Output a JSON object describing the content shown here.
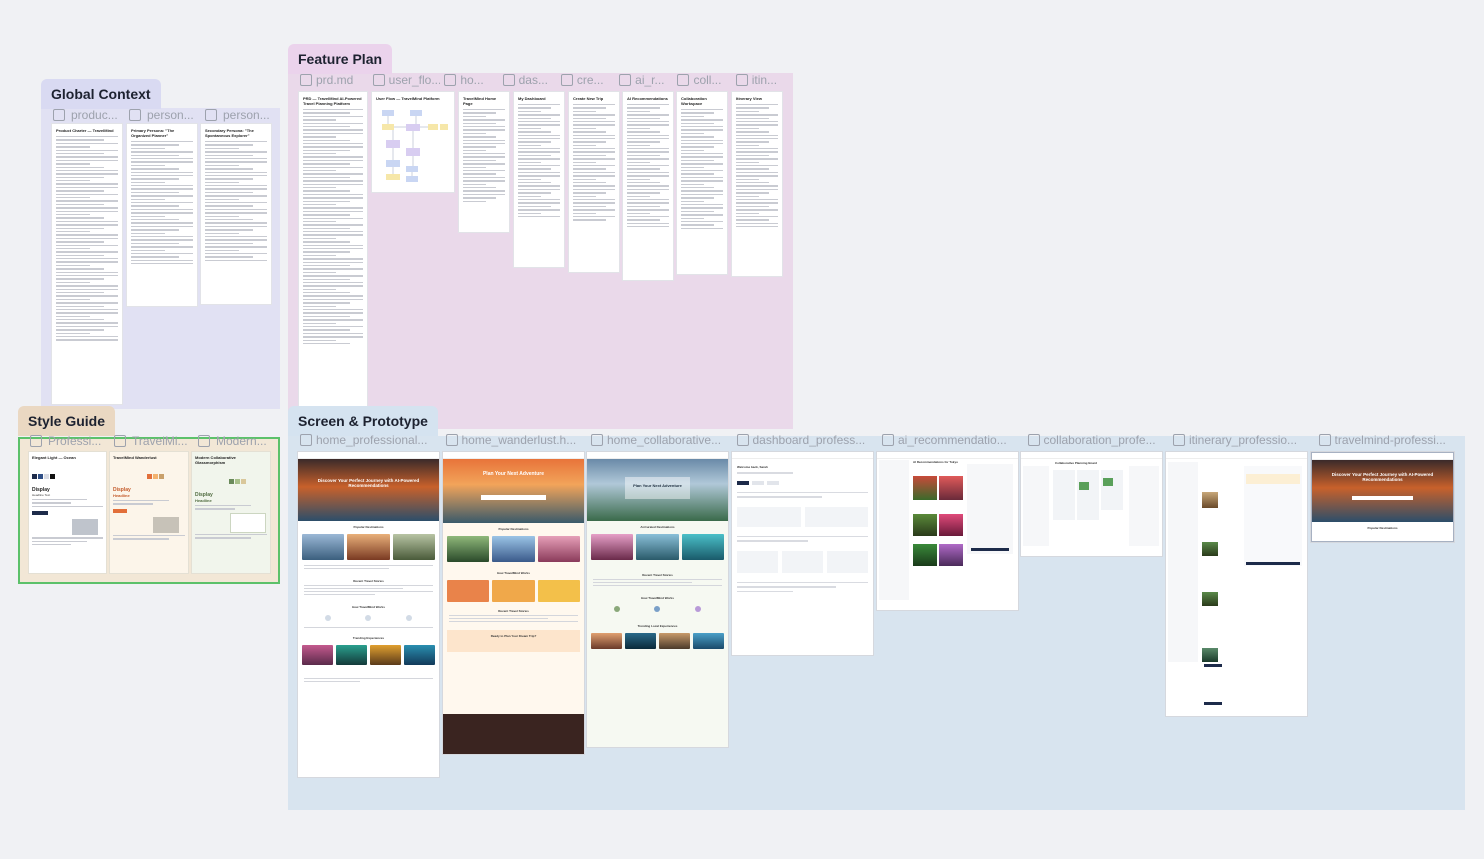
{
  "groups": {
    "global_context": "Global Context",
    "feature_plan": "Feature Plan",
    "style_guide": "Style Guide",
    "screen_prototype": "Screen & Prototype"
  },
  "global_context_files": [
    "produc...",
    "person...",
    "person..."
  ],
  "global_context_docs": [
    "Product Charter — TravelMind",
    "Primary Persona: \"The Organized Planner\"",
    "Secondary Persona: \"The Spontaneous Explorer\""
  ],
  "feature_plan_files": [
    "prd.md",
    "user_flo...",
    "ho...",
    "das...",
    "cre...",
    "ai_r...",
    "coll...",
    "itin..."
  ],
  "feature_plan_docs": [
    "PRD — TravelMind AI-Powered Travel Planning Platform",
    "User Flow — TravelMind Platform",
    "TravelMind Home Page",
    "My Dashboard",
    "Create New Trip",
    "AI Recommendations",
    "Collaboration Workspace",
    "Itinerary View"
  ],
  "style_guide_files": [
    "Professi...",
    "TravelMi...",
    "Modern..."
  ],
  "style_guide_docs": [
    "Elegant Light — Ocean",
    "TravelMind Wanderlust",
    "Modern Collaborative Glassmorphism"
  ],
  "style_guide_display": [
    "Display",
    "Display",
    "Display"
  ],
  "style_guide_headline": [
    "Headline Text",
    "Headline",
    "Headline"
  ],
  "screen_files": [
    "home_professional...",
    "home_wanderlust.h...",
    "home_collaborative...",
    "dashboard_profess...",
    "ai_recommendatio...",
    "collaboration_profe...",
    "itinerary_professio...",
    "travelmind-professi..."
  ],
  "screens": {
    "home1_hero": "Discover Your Perfect Journey with AI-Powered Recommendations",
    "home1_popular": "Popular Destinations",
    "home1_stories": "Recent Travel Stories",
    "home1_how": "How TravelMind Works",
    "home1_trending": "Trending Experiences",
    "home2_hero": "Plan Your Next Adventure",
    "home2_popular": "Popular Destinations",
    "home2_how": "How TravelMind Works",
    "home2_stories": "Recent Travel Stories",
    "home2_cta": "Ready to Plan Your Dream Trip?",
    "home3_hero": "Plan Your Next Adventure",
    "home3_curated": "AI-Curated Destinations",
    "home3_stories": "Recent Travel Stories",
    "home3_how": "How TravelMind Works",
    "home3_trending": "Trending Local Experiences",
    "dash_title": "Welcome back, Sarah",
    "ai_title": "AI Recommendations for Tokyo",
    "collab_title": "Collaborative Planning Board",
    "proto_hero": "Discover Your Perfect Journey with AI-Powered Recommendations",
    "proto_popular": "Popular Destinations"
  },
  "colors": {
    "global_context_bg": "#e1e1f3",
    "global_context_tag": "#d9daf2",
    "feature_plan_bg": "#ead9ea",
    "feature_plan_tag": "#ebd3ec",
    "style_guide_bg": "#f2e7d6",
    "style_guide_tag": "#ead8c2",
    "style_guide_border": "#5cc16a",
    "screen_bg": "#d8e4ef",
    "screen_tag": "#d5e3f0"
  }
}
